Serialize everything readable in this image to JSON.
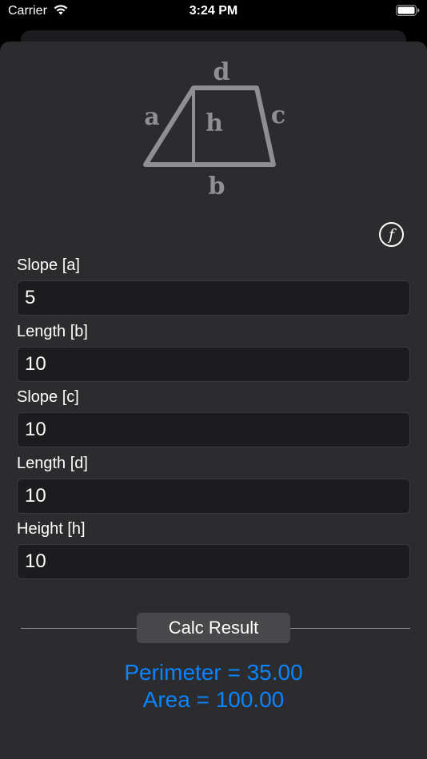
{
  "status": {
    "carrier": "Carrier",
    "time": "3:24 PM"
  },
  "diagram": {
    "labels": {
      "a": "a",
      "b": "b",
      "c": "c",
      "d": "d",
      "h": "h"
    }
  },
  "formula_button": {
    "icon": "function-icon",
    "glyph": "f"
  },
  "fields": [
    {
      "label": "Slope [a]",
      "value": "5"
    },
    {
      "label": "Length [b]",
      "value": "10"
    },
    {
      "label": "Slope [c]",
      "value": "10"
    },
    {
      "label": "Length [d]",
      "value": "10"
    },
    {
      "label": "Height [h]",
      "value": "10"
    }
  ],
  "calc_button": {
    "label": "Calc Result"
  },
  "results": {
    "perimeter": "Perimeter = 35.00",
    "area": "Area = 100.00"
  },
  "colors": {
    "accent": "#0a84ff",
    "sheet": "#2c2c2e",
    "field_bg": "#1c1c1e",
    "diagram": "#8e8e93"
  }
}
